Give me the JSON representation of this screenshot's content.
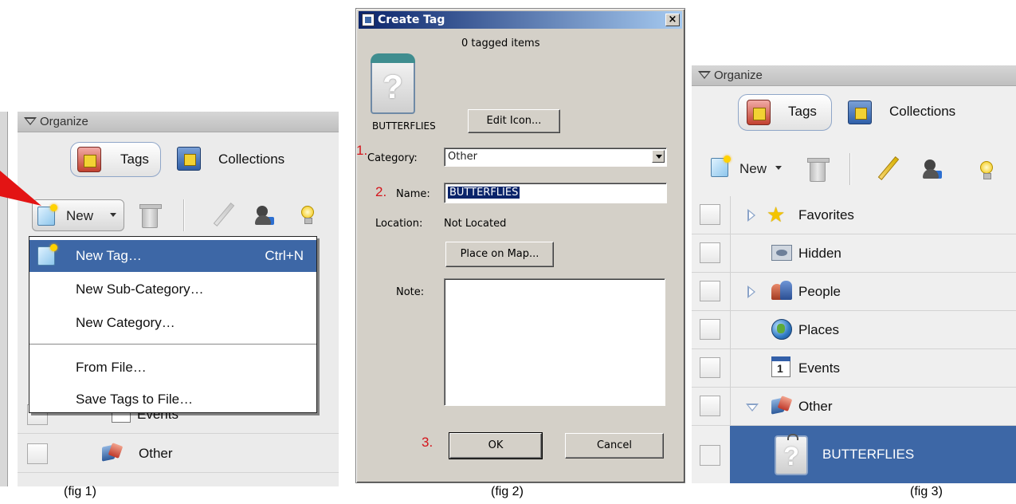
{
  "captions": {
    "fig1": "(fig 1)",
    "fig2": "(fig 2)",
    "fig3": "(fig 3)"
  },
  "fig1": {
    "header": "Organize",
    "tabs": {
      "tags": "Tags",
      "collections": "Collections"
    },
    "new_button": "New",
    "menu": {
      "items": [
        {
          "label": "New Tag…",
          "shortcut": "Ctrl+N"
        },
        {
          "label": "New Sub-Category…"
        },
        {
          "label": "New Category…"
        },
        {
          "label": "From File…"
        },
        {
          "label": "Save Tags to File…"
        }
      ]
    },
    "rows": {
      "events": "Events",
      "other": "Other"
    }
  },
  "fig2": {
    "title": "Create Tag",
    "close": "×",
    "tagged_items": "0 tagged items",
    "tag_name": "BUTTERFLIES",
    "edit_icon": "Edit Icon...",
    "steps": {
      "one": "1.",
      "two": "2.",
      "three": "3."
    },
    "category_label": "Category:",
    "category_value": "Other",
    "name_label": "Name:",
    "name_value": "BUTTERFLIES",
    "location_label": "Location:",
    "location_value": "Not Located",
    "place_on_map": "Place on Map...",
    "note_label": "Note:",
    "ok": "OK",
    "cancel": "Cancel"
  },
  "fig3": {
    "header": "Organize",
    "tabs": {
      "tags": "Tags",
      "collections": "Collections"
    },
    "new_button": "New",
    "rows": [
      {
        "label": "Favorites"
      },
      {
        "label": "Hidden"
      },
      {
        "label": "People"
      },
      {
        "label": "Places"
      },
      {
        "label": "Events",
        "icon_text": "1"
      },
      {
        "label": "Other"
      },
      {
        "label": "BUTTERFLIES"
      }
    ]
  },
  "colors": {
    "selection": "#3d67a6",
    "step_red": "#d4141b",
    "dialog_face": "#d4d0c8"
  }
}
